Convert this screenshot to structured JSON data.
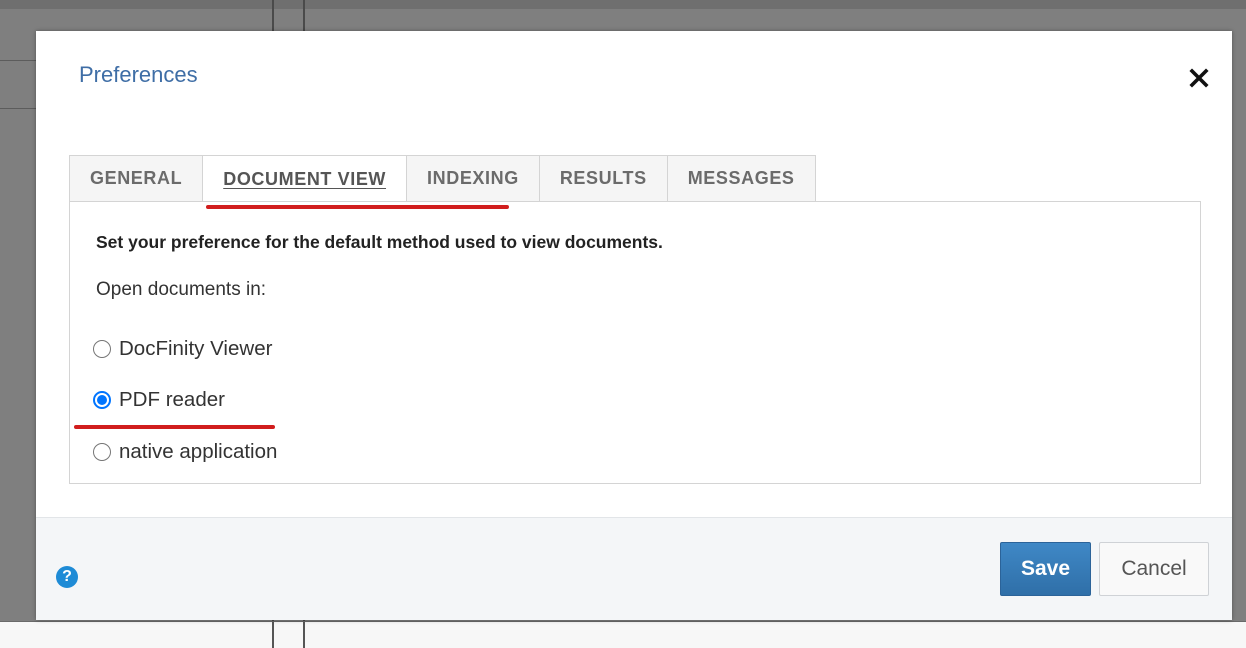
{
  "dialog": {
    "title": "Preferences",
    "close_icon": "close-icon"
  },
  "tabs": [
    {
      "label": "GENERAL",
      "active": false
    },
    {
      "label": "DOCUMENT VIEW",
      "active": true
    },
    {
      "label": "INDEXING",
      "active": false
    },
    {
      "label": "RESULTS",
      "active": false
    },
    {
      "label": "MESSAGES",
      "active": false
    }
  ],
  "document_view": {
    "heading": "Set your preference for the default method used to view documents.",
    "open_label": "Open documents in:",
    "options": [
      {
        "label": "DocFinity Viewer",
        "selected": false
      },
      {
        "label": "PDF reader",
        "selected": true
      },
      {
        "label": "native application",
        "selected": false
      }
    ]
  },
  "footer": {
    "help_icon": "help-icon",
    "help_glyph": "?",
    "save_label": "Save",
    "cancel_label": "Cancel"
  },
  "colors": {
    "title": "#3f6ea6",
    "primary_button": "#2f6fa8",
    "annotation": "#d11d1d",
    "radio_checked": "#0075ff"
  }
}
